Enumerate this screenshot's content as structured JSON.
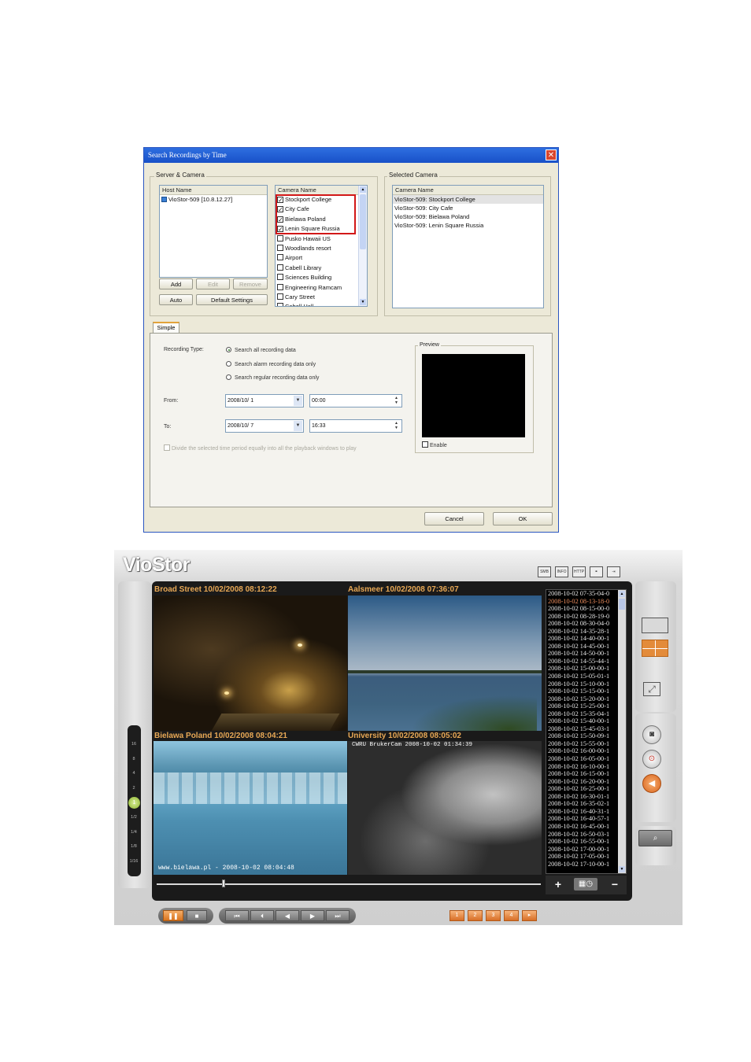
{
  "dialog": {
    "title": "Search Recordings by Time",
    "close_glyph": "✕",
    "server_camera_group": "Server & Camera",
    "selected_camera_group": "Selected Camera",
    "host_list": {
      "header": "Host Name",
      "items": [
        "VioStor-509 [10.8.12.27]"
      ]
    },
    "camera_list": {
      "header": "Camera Name",
      "items": [
        {
          "name": "Stockport College",
          "checked": true
        },
        {
          "name": "City Cafe",
          "checked": true
        },
        {
          "name": "Bielawa Poland",
          "checked": true
        },
        {
          "name": "Lenin Square Russia",
          "checked": true
        },
        {
          "name": "Pusko Hawaii US",
          "checked": false
        },
        {
          "name": "Woodlands resort",
          "checked": false
        },
        {
          "name": "Airport",
          "checked": false
        },
        {
          "name": "Cabell Library",
          "checked": false
        },
        {
          "name": "Sciences Building",
          "checked": false
        },
        {
          "name": "Engineering Ramcam",
          "checked": false
        },
        {
          "name": "Cary Street",
          "checked": false
        },
        {
          "name": "Cabell Hall",
          "checked": false
        }
      ]
    },
    "selected_list": {
      "header": "Camera Name",
      "items": [
        "VioStor-509: Stockport College",
        "VioStor-509: City Cafe",
        "VioStor-509: Bielawa Poland",
        "VioStor-509: Lenin Square Russia"
      ]
    },
    "buttons": {
      "add": "Add",
      "edit": "Edit",
      "remove": "Remove",
      "auto": "Auto",
      "default_settings": "Default Settings",
      "cancel": "Cancel",
      "ok": "OK"
    },
    "tab_simple": "Simple",
    "recording_type_label": "Recording Type:",
    "radio_options": [
      {
        "label": "Search all recording data",
        "selected": true
      },
      {
        "label": "Search alarm recording data only",
        "selected": false
      },
      {
        "label": "Search regular recording data only",
        "selected": false
      }
    ],
    "from_label": "From:",
    "from_date": "2008/10/ 1",
    "from_time": "00:00",
    "to_label": "To:",
    "to_date": "2008/10/ 7",
    "to_time": "16:33",
    "divide_label": "Divide the selected time period equally into all the playback windows to play",
    "preview_label": "Preview",
    "enable_label": "Enable"
  },
  "viostor": {
    "logo": "VioStor",
    "toolbar_icons": [
      "SMB",
      "INFO",
      "HTTP",
      "network-icon",
      "exit-icon"
    ],
    "cameras": [
      {
        "title": "Broad Street 10/02/2008 08:12:22",
        "overlay": ""
      },
      {
        "title": "Aalsmeer 10/02/2008 07:36:07",
        "overlay": ""
      },
      {
        "title": "Bielawa Poland 10/02/2008 08:04:21",
        "overlay": "www.bielawa.pl - 2008-10-02 08:04:48"
      },
      {
        "title": "University 10/02/2008 08:05:02",
        "overlay": "CWRU BrukerCam 2008-10-02 01:34:39"
      }
    ],
    "speeds": [
      "16",
      "8",
      "4",
      "2",
      "1",
      "1/2",
      "1/4",
      "1/8",
      "1/16"
    ],
    "current_speed": "1",
    "timestamps": [
      "2008-10-02 07-35-04-0",
      "2008-10-02 08-13-18-0",
      "2008-10-02 08-15-00-0",
      "2008-10-02 08-28-19-0",
      "2008-10-02 08-30-04-0",
      "2008-10-02 14-35-28-1",
      "2008-10-02 14-40-00-1",
      "2008-10-02 14-45-00-1",
      "2008-10-02 14-50-00-1",
      "2008-10-02 14-55-44-1",
      "2008-10-02 15-00-00-1",
      "2008-10-02 15-05-01-1",
      "2008-10-02 15-10-00-1",
      "2008-10-02 15-15-00-1",
      "2008-10-02 15-20-00-1",
      "2008-10-02 15-25-00-1",
      "2008-10-02 15-35-04-1",
      "2008-10-02 15-40-00-1",
      "2008-10-02 15-45-03-1",
      "2008-10-02 15-50-09-1",
      "2008-10-02 15-55-00-1",
      "2008-10-02 16-00-00-1",
      "2008-10-02 16-05-00-1",
      "2008-10-02 16-10-00-1",
      "2008-10-02 16-15-00-1",
      "2008-10-02 16-20-00-1",
      "2008-10-02 16-25-00-1",
      "2008-10-02 16-30-01-1",
      "2008-10-02 16-35-02-1",
      "2008-10-02 16-40-31-1",
      "2008-10-02 16-40-57-1",
      "2008-10-02 16-45-00-1",
      "2008-10-02 16-50-03-1",
      "2008-10-02 16-55-00-1",
      "2008-10-02 17-00-00-1",
      "2008-10-02 17-05-00-1",
      "2008-10-02 17-10-00-1"
    ],
    "current_timestamp_index": 1,
    "list_controls": {
      "plus": "+",
      "minus": "−"
    },
    "playback_controls": [
      "❚❚",
      "■",
      "⏮",
      "⏴",
      "◀",
      "▶",
      "⏭"
    ],
    "pages": [
      "1",
      "2",
      "3",
      "4",
      "▸"
    ],
    "playback_position": 0.17
  }
}
